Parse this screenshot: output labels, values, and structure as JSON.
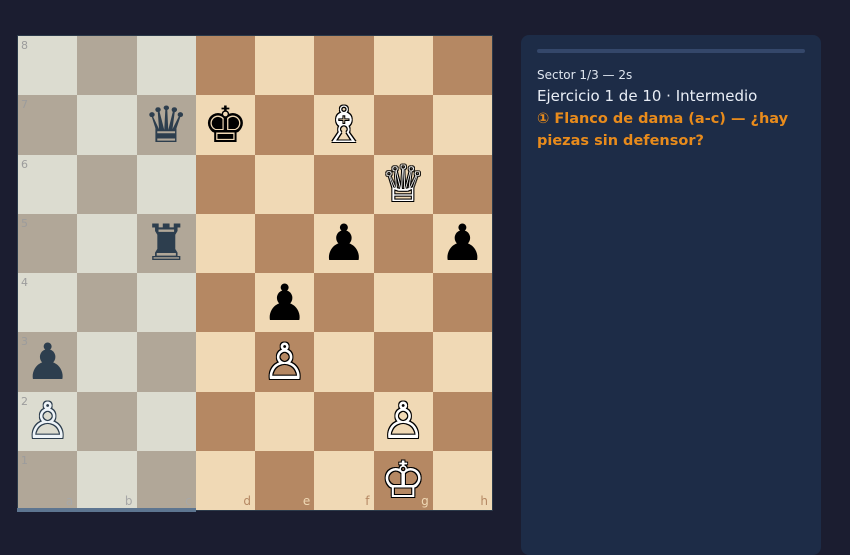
{
  "board": {
    "files": [
      "a",
      "b",
      "c",
      "d",
      "e",
      "f",
      "g",
      "h"
    ],
    "ranks": [
      "8",
      "7",
      "6",
      "5",
      "4",
      "3",
      "2",
      "1"
    ],
    "highlight_files": [
      "a",
      "b",
      "c"
    ],
    "pieces": [
      {
        "square": "c7",
        "color": "b",
        "type": "queen",
        "glyph": "♛"
      },
      {
        "square": "d7",
        "color": "b",
        "type": "king",
        "glyph": "♚"
      },
      {
        "square": "f7",
        "color": "w",
        "type": "bishop",
        "glyph": "♗"
      },
      {
        "square": "g6",
        "color": "w",
        "type": "queen",
        "glyph": "♕"
      },
      {
        "square": "c5",
        "color": "b",
        "type": "rook",
        "glyph": "♜"
      },
      {
        "square": "f5",
        "color": "b",
        "type": "pawn",
        "glyph": "♟"
      },
      {
        "square": "h5",
        "color": "b",
        "type": "pawn",
        "glyph": "♟"
      },
      {
        "square": "e4",
        "color": "b",
        "type": "pawn",
        "glyph": "♟"
      },
      {
        "square": "a3",
        "color": "b",
        "type": "pawn",
        "glyph": "♟"
      },
      {
        "square": "e3",
        "color": "w",
        "type": "pawn",
        "glyph": "♙"
      },
      {
        "square": "a2",
        "color": "w",
        "type": "pawn",
        "glyph": "♙"
      },
      {
        "square": "g2",
        "color": "w",
        "type": "pawn",
        "glyph": "♙"
      },
      {
        "square": "g1",
        "color": "w",
        "type": "king",
        "glyph": "♔"
      }
    ]
  },
  "panel": {
    "sector": "Sector 1/3 — 2s",
    "exercise": "Ejercicio 1 de 10 · Intermedio",
    "question": "① Flanco de dama (a-c) — ¿hay piezas sin defensor?"
  },
  "colors": {
    "light_square": "#f0d9b5",
    "dark_square": "#b58863",
    "light_square_dim": "#dcdcd0",
    "dark_square_dim": "#b1a798",
    "accent": "#e88b1c",
    "panel_bg": "#1d2c47",
    "page_bg": "#1b1d30"
  }
}
